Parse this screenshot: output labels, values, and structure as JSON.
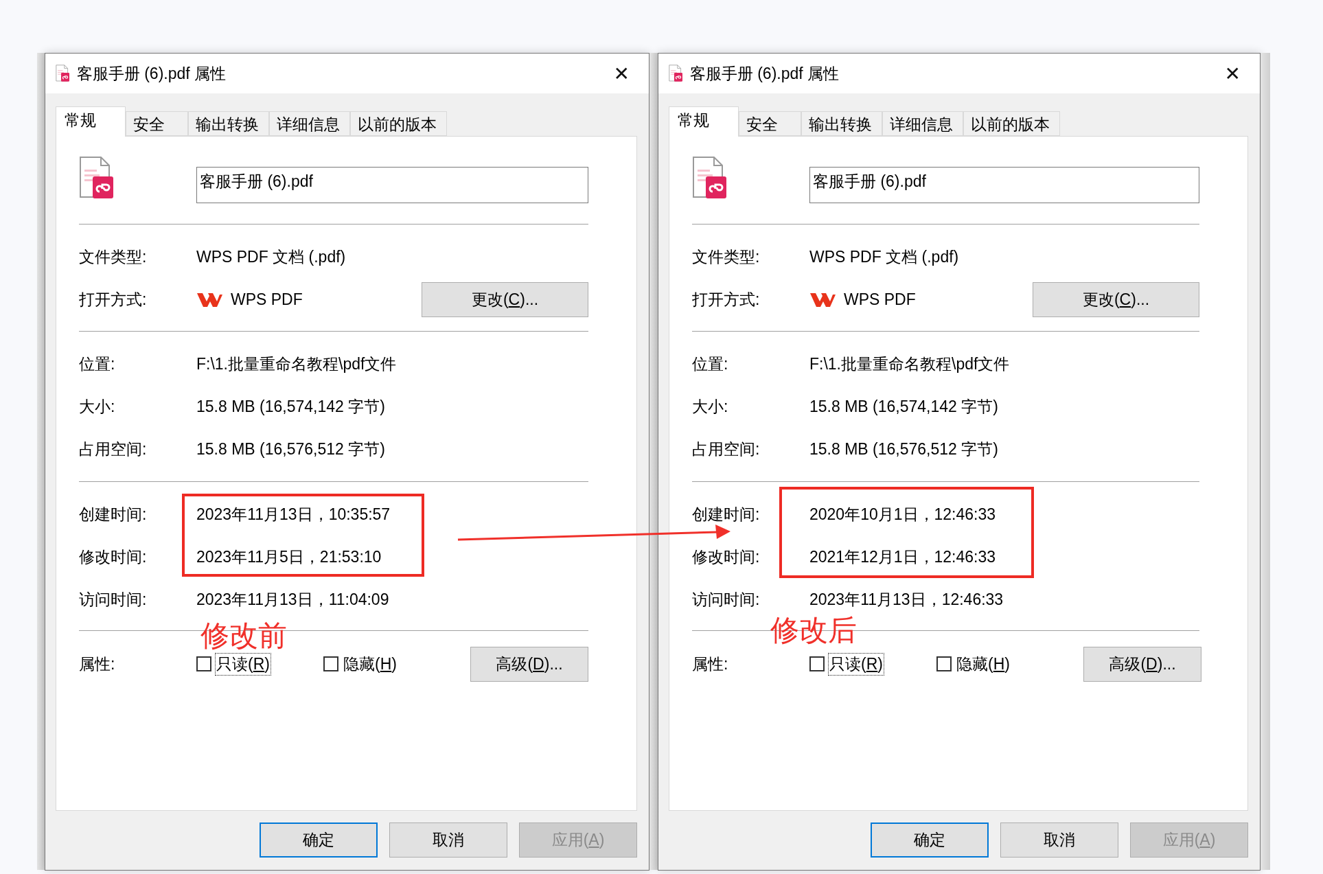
{
  "dialogs": [
    {
      "title": "客服手册 (6).pdf 属性",
      "close": "✕",
      "tabs": [
        {
          "label": "常规",
          "selected": true
        },
        {
          "label": "安全",
          "selected": false
        },
        {
          "label": "输出转换",
          "selected": false
        },
        {
          "label": "详细信息",
          "selected": false
        },
        {
          "label": "以前的版本",
          "selected": false
        }
      ],
      "file_name": "客服手册 (6).pdf",
      "type_row": {
        "label": "文件类型:",
        "value": "WPS PDF 文档 (.pdf)"
      },
      "open_with": {
        "label": "打开方式:",
        "app": "WPS PDF",
        "button": {
          "before": "更改(",
          "key": "C",
          "after": ")..."
        }
      },
      "location_rows": [
        {
          "label": "位置:",
          "value": "F:\\1.批量重命名教程\\pdf文件"
        },
        {
          "label": "大小:",
          "value": "15.8 MB (16,574,142 字节)"
        },
        {
          "label": "占用空间:",
          "value": "15.8 MB (16,576,512 字节)"
        }
      ],
      "time_rows": [
        {
          "label": "创建时间:",
          "value": "2023年11月13日，10:35:57"
        },
        {
          "label": "修改时间:",
          "value": "2023年11月5日，21:53:10"
        },
        {
          "label": "访问时间:",
          "value": "2023年11月13日，11:04:09"
        }
      ],
      "times_highlighted": true,
      "attributes": {
        "label": "属性:",
        "checkboxes": [
          {
            "before": "只读(",
            "key": "R",
            "after": ")",
            "checked": false,
            "focused": true
          },
          {
            "before": "隐藏(",
            "key": "H",
            "after": ")",
            "checked": false,
            "focused": false
          }
        ],
        "advanced_button": {
          "before": "高级(",
          "key": "D",
          "after": ")..."
        }
      },
      "annotation": "修改前",
      "buttons": [
        {
          "before": "确定",
          "kind": "default"
        },
        {
          "before": "取消",
          "kind": "normal"
        },
        {
          "before": "应用(",
          "key": "A",
          "after": ")",
          "kind": "disabled"
        }
      ]
    },
    {
      "title": "客服手册 (6).pdf 属性",
      "close": "✕",
      "tabs": [
        {
          "label": "常规",
          "selected": true
        },
        {
          "label": "安全",
          "selected": false
        },
        {
          "label": "输出转换",
          "selected": false
        },
        {
          "label": "详细信息",
          "selected": false
        },
        {
          "label": "以前的版本",
          "selected": false
        }
      ],
      "file_name": "客服手册 (6).pdf",
      "type_row": {
        "label": "文件类型:",
        "value": "WPS PDF 文档 (.pdf)"
      },
      "open_with": {
        "label": "打开方式:",
        "app": "WPS PDF",
        "button": {
          "before": "更改(",
          "key": "C",
          "after": ")..."
        }
      },
      "location_rows": [
        {
          "label": "位置:",
          "value": "F:\\1.批量重命名教程\\pdf文件"
        },
        {
          "label": "大小:",
          "value": "15.8 MB (16,574,142 字节)"
        },
        {
          "label": "占用空间:",
          "value": "15.8 MB (16,576,512 字节)"
        }
      ],
      "time_rows": [
        {
          "label": "创建时间:",
          "value": "2020年10月1日，12:46:33"
        },
        {
          "label": "修改时间:",
          "value": "2021年12月1日，12:46:33"
        },
        {
          "label": "访问时间:",
          "value": "2023年11月13日，12:46:33"
        }
      ],
      "times_highlighted": true,
      "attributes": {
        "label": "属性:",
        "checkboxes": [
          {
            "before": "只读(",
            "key": "R",
            "after": ")",
            "checked": false,
            "focused": true
          },
          {
            "before": "隐藏(",
            "key": "H",
            "after": ")",
            "checked": false,
            "focused": false
          }
        ],
        "advanced_button": {
          "before": "高级(",
          "key": "D",
          "after": ")..."
        }
      },
      "annotation": "修改后",
      "buttons": [
        {
          "before": "确定",
          "kind": "default"
        },
        {
          "before": "取消",
          "kind": "normal"
        },
        {
          "before": "应用(",
          "key": "A",
          "after": ")",
          "kind": "disabled"
        }
      ]
    }
  ]
}
